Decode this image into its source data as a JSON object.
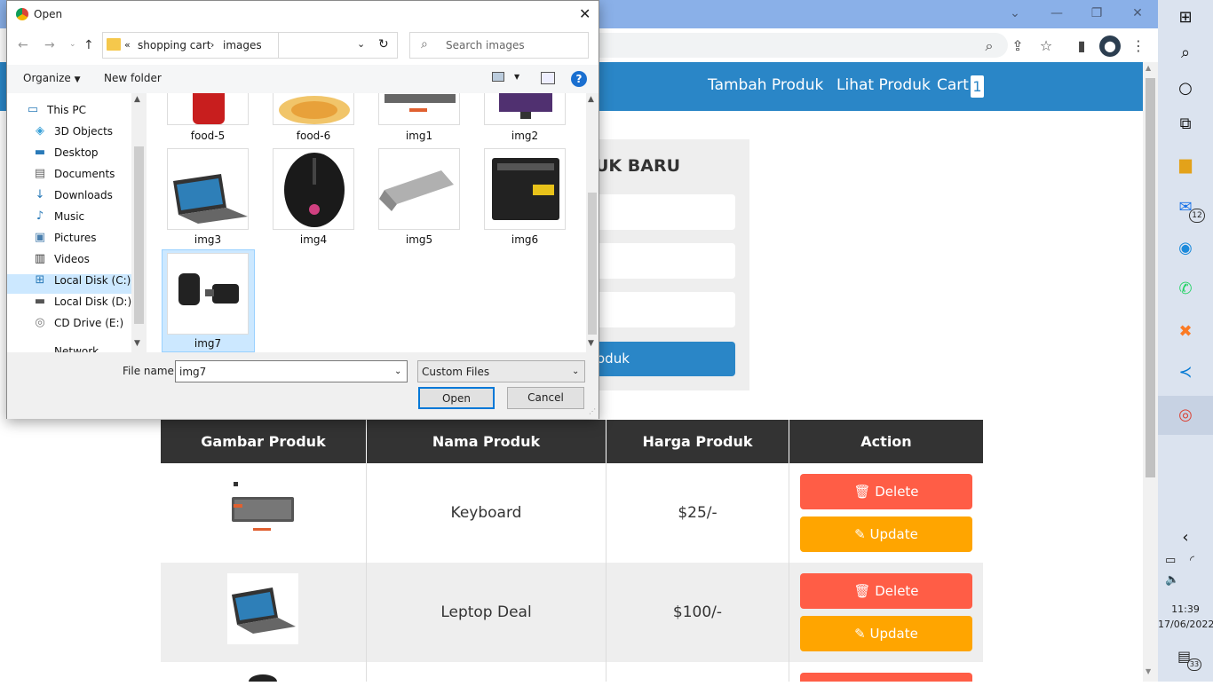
{
  "browser": {
    "nav": {
      "tambah": "Tambah Produk",
      "lihat": "Lihat Produk",
      "cart": "Cart",
      "cart_count": "1"
    },
    "form": {
      "title_visible": "UK BARU",
      "submit_label_visible": "oduk"
    },
    "table": {
      "headers": [
        "Gambar Produk",
        "Nama Produk",
        "Harga Produk",
        "Action"
      ],
      "rows": [
        {
          "name": "Keyboard",
          "price": "$25/-",
          "delete": "Delete",
          "update": "Update"
        },
        {
          "name": "Leptop Deal",
          "price": "$100/-",
          "delete": "Delete",
          "update": "Update"
        }
      ]
    }
  },
  "dialog": {
    "title": "Open",
    "breadcrumb": [
      "shopping cart",
      "images"
    ],
    "breadcrumb_prefix": "«",
    "search_placeholder": "Search images",
    "organize": "Organize",
    "new_folder": "New folder",
    "nav_items": [
      "This PC",
      "3D Objects",
      "Desktop",
      "Documents",
      "Downloads",
      "Music",
      "Pictures",
      "Videos",
      "Local Disk (C:)",
      "Local Disk (D:)",
      "CD Drive (E:)",
      "Network"
    ],
    "files": [
      "food-5",
      "food-6",
      "img1",
      "img2",
      "img3",
      "img4",
      "img5",
      "img6",
      "img7"
    ],
    "selected_file": "img7",
    "file_name_label": "File name:",
    "file_name_value": "img7",
    "file_type": "Custom Files",
    "open_label": "Open",
    "cancel_label": "Cancel"
  },
  "taskbar": {
    "mail_badge": "12",
    "time": "11:39",
    "date": "17/06/2022",
    "notif_count": "33"
  }
}
